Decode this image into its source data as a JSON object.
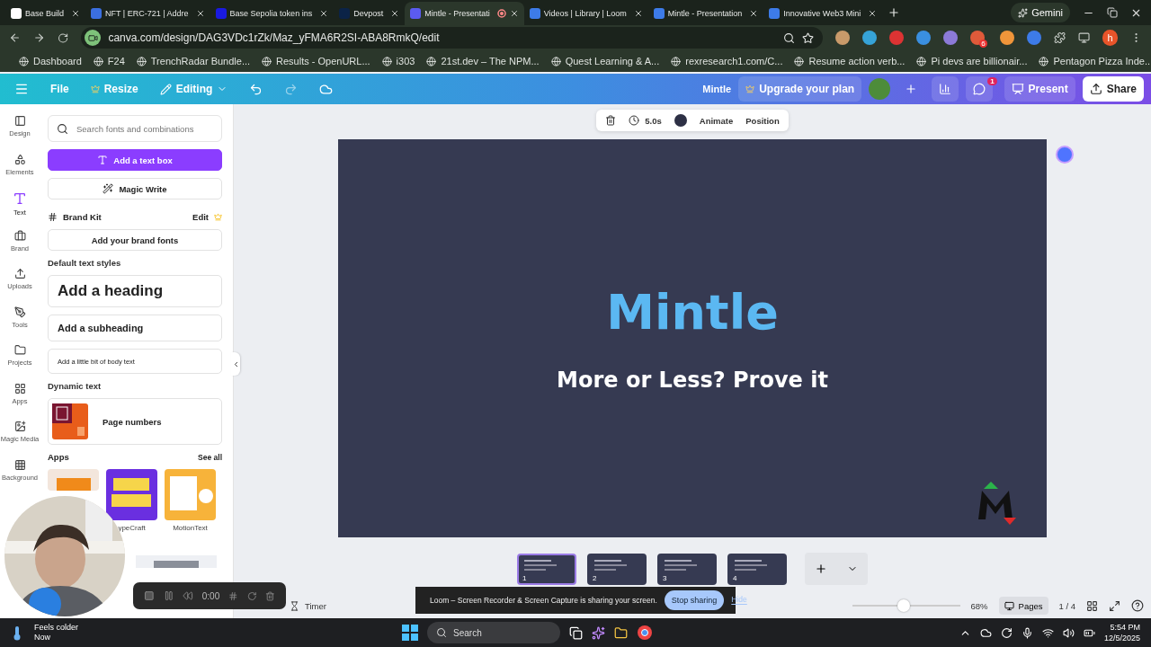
{
  "browser": {
    "tabs": [
      {
        "title": "Base Build",
        "selected": false,
        "recording": false
      },
      {
        "title": "NFT | ERC-721 | Addre",
        "selected": false,
        "recording": false
      },
      {
        "title": "Base Sepolia token ins",
        "selected": false,
        "recording": false
      },
      {
        "title": "Devpost",
        "selected": false,
        "recording": false
      },
      {
        "title": "Mintle - Presentati",
        "selected": true,
        "recording": true
      },
      {
        "title": "Videos | Library | Loom",
        "selected": false,
        "recording": false
      },
      {
        "title": "Mintle - Presentation",
        "selected": false,
        "recording": false
      },
      {
        "title": "Innovative Web3 Mini",
        "selected": false,
        "recording": false
      }
    ],
    "gemini": "Gemini",
    "url": "canva.com/design/DAG3VDc1rZk/Maz_yFMA6R2SI-ABA8RmkQ/edit",
    "extension_badge": "6",
    "profile": "h",
    "bookmarks": [
      "Dashboard",
      "F24",
      "TrenchRadar Bundle...",
      "Results - OpenURL...",
      "i303",
      "21st.dev – The NPM...",
      "Quest Learning & A...",
      "rexresearch1.com/C...",
      "Resume action verb...",
      "Pi devs are billionair...",
      "Pentagon Pizza Inde..."
    ]
  },
  "header": {
    "file": "File",
    "resize": "Resize",
    "mode": "Editing",
    "title": "Mintle",
    "upgrade": "Upgrade your plan",
    "comment_badge": "1",
    "present": "Present",
    "share": "Share"
  },
  "rail": [
    {
      "label": "Design",
      "selected": false
    },
    {
      "label": "Elements",
      "selected": false
    },
    {
      "label": "Text",
      "selected": true
    },
    {
      "label": "Brand",
      "selected": false
    },
    {
      "label": "Uploads",
      "selected": false
    },
    {
      "label": "Tools",
      "selected": false
    },
    {
      "label": "Projects",
      "selected": false
    },
    {
      "label": "Apps",
      "selected": false
    },
    {
      "label": "Magic Media",
      "selected": false
    },
    {
      "label": "Background",
      "selected": false
    }
  ],
  "panel": {
    "search": {
      "placeholder": "Search fonts and combinations"
    },
    "add_text_box": "Add a text box",
    "magic_write": "Magic Write",
    "brand_kit": "Brand Kit",
    "brand_edit": "Edit",
    "brand_fonts": "Add your brand fonts",
    "default_styles": "Default text styles",
    "heading": "Add a heading",
    "subheading": "Add a subheading",
    "body": "Add a little bit of body text",
    "dynamic": "Dynamic text",
    "page_numbers": "Page numbers",
    "apps_title": "Apps",
    "see_all": "See all",
    "apps": [
      {
        "label": "ypeCraft"
      },
      {
        "label": "MotionText"
      }
    ]
  },
  "toolbar": {
    "duration": "5.0s",
    "animate": "Animate",
    "position": "Position"
  },
  "slide": {
    "title": "Mintle",
    "subtitle": "More or Less? Prove it"
  },
  "pages": [
    {
      "number": "1",
      "selected": true
    },
    {
      "number": "2",
      "selected": false
    },
    {
      "number": "3",
      "selected": false
    },
    {
      "number": "4",
      "selected": false
    }
  ],
  "footer": {
    "timer": "Timer",
    "zoom": {
      "level": 0.48
    },
    "zoom_text": "68%",
    "pages": "Pages",
    "page_count": "1 / 4"
  },
  "recorder": {
    "time": "0:00"
  },
  "loom": {
    "message": "Loom – Screen Recorder & Screen Capture is sharing your screen.",
    "stop": "Stop sharing",
    "hide": "Hide"
  },
  "taskbar": {
    "weather": "Feels colder",
    "weather_time": "Now",
    "search": "Search",
    "time": "5:54 PM",
    "date": "12/5/2025"
  }
}
